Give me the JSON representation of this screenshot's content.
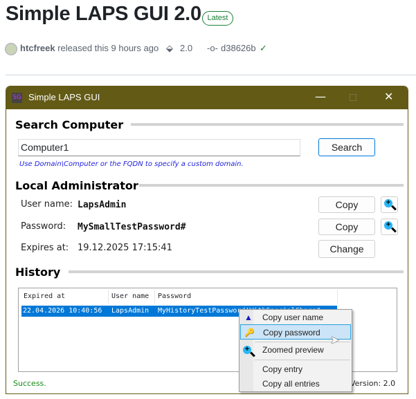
{
  "release": {
    "title": "Simple LAPS GUI 2.0",
    "badge": "Latest",
    "author": "htcfreek",
    "released": "released this 9 hours ago",
    "tag": "2.0",
    "commit": "d38626b"
  },
  "window": {
    "title": "Simple LAPS GUI",
    "search": {
      "heading": "Search Computer",
      "value": "Computer1",
      "button": "Search",
      "hint": "Use Domain\\Computer or the FQDN to specify a custom domain."
    },
    "admin": {
      "heading": "Local Administrator",
      "user_label": "User name:",
      "user": "LapsAdmin",
      "pw_label": "Password:",
      "pw": "MySmallTestPassword#",
      "exp_label": "Expires at:",
      "exp": "19.12.2025 17:15:41",
      "copy": "Copy",
      "change": "Change"
    },
    "history": {
      "heading": "History",
      "columns": [
        "Expired at",
        "User name",
        "Password"
      ],
      "rows": [
        {
          "expired": "22.04.2026 10:40:56",
          "user": "LapsAdmin",
          "password": "MyHistoryTestPassword!WithSpecialChars#"
        }
      ]
    },
    "status": "Success.",
    "version": "Version: 2.0"
  },
  "menu": {
    "items": [
      "Copy user name",
      "Copy password",
      "Zoomed preview",
      "Copy entry",
      "Copy all entries"
    ]
  }
}
